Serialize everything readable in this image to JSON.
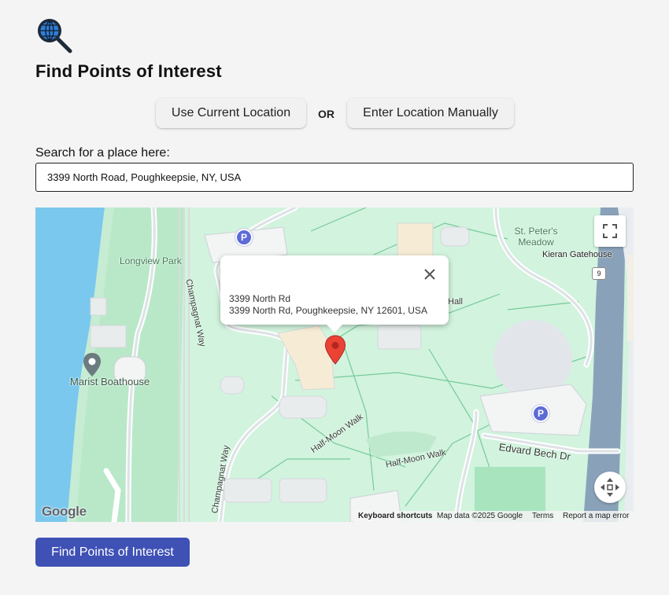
{
  "page": {
    "title": "Find Points of Interest",
    "logo_icon": "globe-magnifier-icon"
  },
  "location_options": {
    "current_label": "Use Current Location",
    "or_label": "OR",
    "manual_label": "Enter Location Manually"
  },
  "search": {
    "label": "Search for a place here:",
    "value": "3399 North Road, Poughkeepsie, NY, USA"
  },
  "map": {
    "labels": {
      "longview_park": "Longview Park",
      "champagnat_way_north": "Champagnat Way",
      "champagnat_way_south": "Champagnat Way",
      "st_peters_meadow": "St. Peter's Meadow",
      "kieran_gatehouse": "Kieran Gatehouse",
      "marist_boathouse": "Marist Boathouse",
      "half_moon_walk_1": "Half-Moon Walk",
      "half_moon_walk_2": "Half-Moon Walk",
      "edvard_bech_dr": "Edvard Bech Dr",
      "hall_fragment": "Hall",
      "route_shield": "9",
      "parking_label": "P"
    },
    "popup": {
      "name": "3399 North Rd",
      "address": "3399 North Rd, Poughkeepsie, NY 12601, USA"
    },
    "footer": {
      "keyboard": "Keyboard shortcuts",
      "map_data": "Map data ©2025 Google",
      "terms": "Terms",
      "report": "Report a map error"
    },
    "attribution": "Google",
    "icons": {
      "fullscreen": "fullscreen-icon",
      "recenter": "recenter-icon",
      "close": "close-icon",
      "marker": "map-marker-icon"
    }
  },
  "actions": {
    "find_label": "Find Points of Interest"
  },
  "colors": {
    "primary_button": "#3f51b5",
    "map_park": "#d2f3de",
    "map_water": "#7ac8ee",
    "marker": "#ea4335"
  }
}
